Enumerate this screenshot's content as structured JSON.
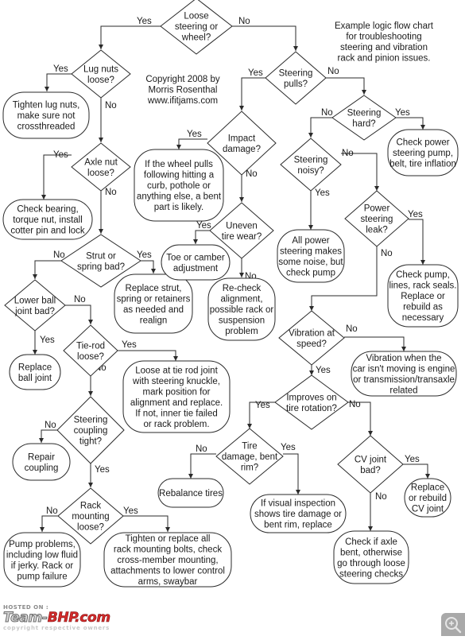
{
  "diagram": {
    "title_note": [
      "Example logic flow chart",
      "for troubleshooting",
      "steering and vibration",
      "rack and pinion issues."
    ],
    "copyright": [
      "Copyright 2008 by",
      "Morris Rosenthal",
      "www.ifitjams.com"
    ],
    "nodes": [
      {
        "id": "loose",
        "type": "decision",
        "lines": [
          "Loose",
          "steering or",
          "wheel?"
        ]
      },
      {
        "id": "lugnuts",
        "type": "decision",
        "lines": [
          "Lug nuts",
          "loose?"
        ]
      },
      {
        "id": "tighten",
        "type": "terminal",
        "lines": [
          "Tighten lug nuts,",
          "make sure not",
          "crossthreaded"
        ]
      },
      {
        "id": "axlenut",
        "type": "decision",
        "lines": [
          "Axle nut",
          "loose?"
        ]
      },
      {
        "id": "bearing",
        "type": "terminal",
        "lines": [
          "Check bearing,",
          "torque nut, install",
          "cotter pin and lock"
        ]
      },
      {
        "id": "strut",
        "type": "decision",
        "lines": [
          "Strut or",
          "spring bad?"
        ]
      },
      {
        "id": "replacestrut",
        "type": "terminal",
        "lines": [
          "Replace strut,",
          "spring or retainers",
          "as needed and",
          "realign"
        ]
      },
      {
        "id": "balljoint",
        "type": "decision",
        "lines": [
          "Lower ball",
          "joint bad?"
        ]
      },
      {
        "id": "replaceball",
        "type": "terminal",
        "lines": [
          "Replace",
          "ball joint"
        ]
      },
      {
        "id": "tierod",
        "type": "decision",
        "lines": [
          "Tie-rod",
          "loose?"
        ]
      },
      {
        "id": "tierodfix",
        "type": "terminal",
        "lines": [
          "Loose at tie rod joint",
          "with steering knuckle,",
          "mark position for",
          "alignment and replace.",
          "If not, inner tie failed",
          "or rack problem."
        ]
      },
      {
        "id": "coupling",
        "type": "decision",
        "lines": [
          "Steering",
          "coupling",
          "tight?"
        ]
      },
      {
        "id": "repaircoupling",
        "type": "terminal",
        "lines": [
          "Repair",
          "coupling"
        ]
      },
      {
        "id": "rack",
        "type": "decision",
        "lines": [
          "Rack",
          "mounting",
          "loose?"
        ]
      },
      {
        "id": "pump",
        "type": "terminal",
        "lines": [
          "Pump problems,",
          "including low fluid",
          "if jerky. Rack or",
          "pump failure"
        ]
      },
      {
        "id": "rackbolts",
        "type": "terminal",
        "lines": [
          "Tighten or replace all",
          "rack mounting bolts, check",
          "cross-member mounting,",
          "attachments to lower control",
          "arms, swaybar"
        ]
      },
      {
        "id": "pulls",
        "type": "decision",
        "lines": [
          "Steering",
          "pulls?"
        ]
      },
      {
        "id": "impact",
        "type": "decision",
        "lines": [
          "Impact",
          "damage?"
        ]
      },
      {
        "id": "bent",
        "type": "terminal",
        "lines": [
          "If the wheel pulls",
          "following hitting a",
          "curb, pothole or",
          "anything else, a bent",
          "part is likely."
        ]
      },
      {
        "id": "uneven",
        "type": "decision",
        "lines": [
          "Uneven",
          "tire wear?"
        ]
      },
      {
        "id": "toe",
        "type": "terminal",
        "lines": [
          "Toe or camber",
          "adjustment"
        ]
      },
      {
        "id": "recheck",
        "type": "terminal",
        "lines": [
          "Re-check",
          "alignment,",
          "possible rack or",
          "suspension",
          "problem"
        ]
      },
      {
        "id": "hard",
        "type": "decision",
        "lines": [
          "Steering",
          "hard?"
        ]
      },
      {
        "id": "checkpower",
        "type": "terminal",
        "lines": [
          "Check power",
          "steering pump,",
          "belt, tire inflation"
        ]
      },
      {
        "id": "noisy",
        "type": "decision",
        "lines": [
          "Steering",
          "noisy?"
        ]
      },
      {
        "id": "allpower",
        "type": "terminal",
        "lines": [
          "All power",
          "steering makes",
          "some noise, but",
          "check pump"
        ]
      },
      {
        "id": "leak",
        "type": "decision",
        "lines": [
          "Power",
          "steering",
          "leak?"
        ]
      },
      {
        "id": "checkpump",
        "type": "terminal",
        "lines": [
          "Check pump,",
          "lines, rack seals.",
          "Replace or",
          "rebuild as",
          "necessary"
        ]
      },
      {
        "id": "vibration",
        "type": "decision",
        "lines": [
          "Vibration at",
          "speed?"
        ]
      },
      {
        "id": "engine",
        "type": "terminal",
        "lines": [
          "Vibration when the",
          "car isn't moving is engine",
          "or transmission/transaxle",
          "related"
        ]
      },
      {
        "id": "rotation",
        "type": "decision",
        "lines": [
          "Improves on",
          "tire rotation?"
        ]
      },
      {
        "id": "tiredamage",
        "type": "decision",
        "lines": [
          "Tire",
          "damage, bent",
          "rim?"
        ]
      },
      {
        "id": "rebalance",
        "type": "terminal",
        "lines": [
          "Rebalance tires"
        ]
      },
      {
        "id": "visual",
        "type": "terminal",
        "lines": [
          "If visual inspection",
          "shows tire damage or",
          "bent rim, replace"
        ]
      },
      {
        "id": "cvjoint",
        "type": "decision",
        "lines": [
          "CV joint",
          "bad?"
        ]
      },
      {
        "id": "replacecv",
        "type": "terminal",
        "lines": [
          "Replace",
          "or rebuild",
          "CV joint"
        ]
      },
      {
        "id": "axlebent",
        "type": "terminal",
        "lines": [
          "Check if axle",
          "bent, otherwise",
          "go through loose",
          "steering checks"
        ]
      }
    ],
    "edges": [
      {
        "from": "loose",
        "to": "lugnuts",
        "label": "Yes"
      },
      {
        "from": "loose",
        "to": "pulls",
        "label": "No"
      },
      {
        "from": "lugnuts",
        "to": "tighten",
        "label": "Yes"
      },
      {
        "from": "lugnuts",
        "to": "axlenut",
        "label": "No"
      },
      {
        "from": "axlenut",
        "to": "bearing",
        "label": "Yes"
      },
      {
        "from": "axlenut",
        "to": "strut",
        "label": "No"
      },
      {
        "from": "strut",
        "to": "balljoint",
        "label": "No"
      },
      {
        "from": "strut",
        "to": "replacestrut",
        "label": "Yes"
      },
      {
        "from": "balljoint",
        "to": "replaceball",
        "label": "Yes"
      },
      {
        "from": "balljoint",
        "to": "tierod",
        "label": "No"
      },
      {
        "from": "tierod",
        "to": "tierodfix",
        "label": "Yes"
      },
      {
        "from": "tierod",
        "to": "coupling",
        "label": "No"
      },
      {
        "from": "coupling",
        "to": "repaircoupling",
        "label": "No"
      },
      {
        "from": "coupling",
        "to": "rack",
        "label": "Yes"
      },
      {
        "from": "rack",
        "to": "pump",
        "label": "No"
      },
      {
        "from": "rack",
        "to": "rackbolts",
        "label": "Yes"
      },
      {
        "from": "pulls",
        "to": "impact",
        "label": "Yes"
      },
      {
        "from": "pulls",
        "to": "hard",
        "label": "No"
      },
      {
        "from": "impact",
        "to": "bent",
        "label": "Yes"
      },
      {
        "from": "impact",
        "to": "uneven",
        "label": "No"
      },
      {
        "from": "uneven",
        "to": "toe",
        "label": "Yes"
      },
      {
        "from": "uneven",
        "to": "recheck",
        "label": "No"
      },
      {
        "from": "hard",
        "to": "checkpower",
        "label": "Yes"
      },
      {
        "from": "hard",
        "to": "noisy",
        "label": "No"
      },
      {
        "from": "noisy",
        "to": "allpower",
        "label": "Yes"
      },
      {
        "from": "noisy",
        "to": "leak",
        "label": "No"
      },
      {
        "from": "leak",
        "to": "checkpump",
        "label": "Yes"
      },
      {
        "from": "leak",
        "to": "vibration",
        "label": "No"
      },
      {
        "from": "vibration",
        "to": "engine",
        "label": "No"
      },
      {
        "from": "vibration",
        "to": "rotation",
        "label": "Yes"
      },
      {
        "from": "rotation",
        "to": "tiredamage",
        "label": "Yes"
      },
      {
        "from": "rotation",
        "to": "cvjoint",
        "label": "No"
      },
      {
        "from": "tiredamage",
        "to": "rebalance",
        "label": "No"
      },
      {
        "from": "tiredamage",
        "to": "visual",
        "label": "Yes"
      },
      {
        "from": "cvjoint",
        "to": "replacecv",
        "label": "Yes"
      },
      {
        "from": "cvjoint",
        "to": "axlebent",
        "label": "No"
      }
    ]
  },
  "watermark": {
    "hosted_on": "HOSTED ON :",
    "logo_team": "Team-",
    "logo_bhp": "BHP.com",
    "copyright": "copyright respective owners"
  },
  "controls": {
    "zoom_icon": "zoom-in-icon"
  }
}
